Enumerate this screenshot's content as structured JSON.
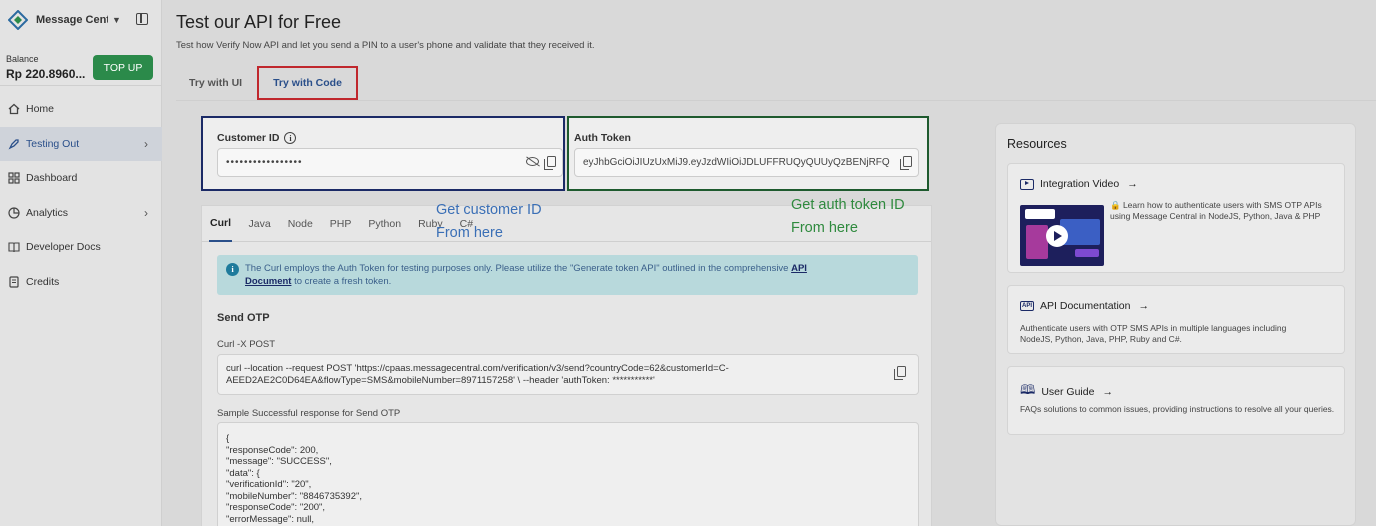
{
  "sidebar": {
    "brand": "Message Central",
    "balance_label": "Balance",
    "balance_amount": "Rp 220.8960...",
    "topup_label": "TOP UP",
    "items": [
      {
        "label": "Home"
      },
      {
        "label": "Testing Out"
      },
      {
        "label": "Dashboard"
      },
      {
        "label": "Analytics"
      },
      {
        "label": "Developer Docs"
      },
      {
        "label": "Credits"
      }
    ]
  },
  "header": {
    "title": "Test our API for Free",
    "subtitle": "Test how Verify Now API and let you send a PIN to a user's phone and validate that they received it.",
    "tabs": [
      {
        "label": "Try with UI"
      },
      {
        "label": "Try with Code"
      }
    ]
  },
  "customer": {
    "label": "Customer ID",
    "value": "•••••••••••••••••"
  },
  "auth": {
    "label": "Auth Token",
    "value": "eyJhbGciOiJIUzUxMiJ9.eyJzdWIiOiJDLUFFRUQyQUUyQzBENjRFQ"
  },
  "callouts": {
    "customer_line1": "Get customer ID",
    "customer_line2": "From here",
    "auth_line1": "Get auth token ID",
    "auth_line2": "From here"
  },
  "code": {
    "languages": [
      "Curl",
      "Java",
      "Node",
      "PHP",
      "Python",
      "Ruby",
      "C#"
    ],
    "note_text": "The Curl employs the Auth Token for testing purposes only. Please utilize the \"Generate token API\" outlined in the comprehensive",
    "note_link1": "API",
    "note_link2": "Document",
    "note_tail": "to create a fresh token.",
    "section_title": "Send OTP",
    "curl_label": "Curl -X POST",
    "curl_line1": "curl --location --request POST 'https://cpaas.messagecentral.com/verification/v3/send?countryCode=62&customerId=C-",
    "curl_line2": "AEED2AE2C0D64EA&flowType=SMS&mobileNumber=8971157258' \\ --header 'authToken: ***********'",
    "response_label": "Sample Successful response for Send OTP",
    "response_lines": [
      "{",
      "\"responseCode\": 200,",
      "\"message\": \"SUCCESS\",",
      "\"data\": {",
      "\"verificationId\": \"20\",",
      "\"mobileNumber\": \"8846735392\",",
      "\"responseCode\": \"200\",",
      "\"errorMessage\": null,"
    ]
  },
  "resources": {
    "title": "Resources",
    "cards": [
      {
        "title": "Integration Video",
        "desc": "🔒 Learn how to authenticate users with SMS OTP APIs using Message Central in NodeJS, Python, Java & PHP"
      },
      {
        "title": "API Documentation",
        "desc": "Authenticate users with OTP SMS APIs in multiple languages including NodeJS, Python, Java, PHP, Ruby and C#."
      },
      {
        "title": "User Guide",
        "desc": "FAQs solutions to common issues, providing instructions to resolve all your queries."
      }
    ]
  },
  "colors": {
    "accent_green": "#2b8a4a",
    "accent_blue": "#2a4f8a",
    "highlight_red": "#c0272d"
  }
}
